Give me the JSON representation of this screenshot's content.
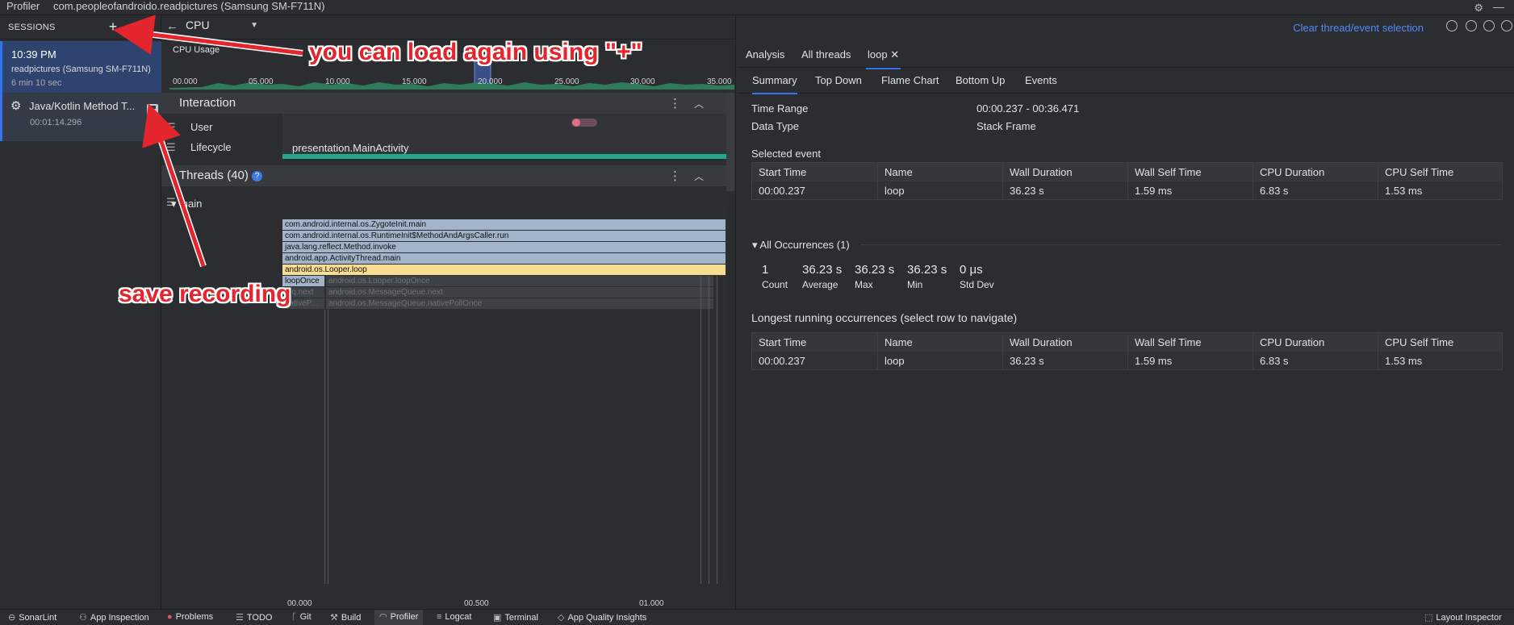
{
  "top": {
    "profiler_tab": "Profiler",
    "session_tab": "com.peopleofandroido.readpictures (Samsung SM-F711N)"
  },
  "sessions": {
    "title": "SESSIONS",
    "add": "+",
    "items": [
      {
        "time": "10:39 PM",
        "device": "readpictures (Samsung SM-F711N)",
        "duration": "6 min 10 sec"
      },
      {
        "name": "Java/Kotlin Method T...",
        "time": "00:01:14.296"
      }
    ]
  },
  "cpu": {
    "selector": "CPU",
    "usage_label": "CPU Usage",
    "ticks": [
      "00.000",
      "05.000",
      "10.000",
      "15.000",
      "20.000",
      "25.000",
      "30.000",
      "35.000"
    ],
    "interaction_title": "Interaction",
    "user_label": "User",
    "lifecycle_label": "Lifecycle",
    "activity": "presentation.MainActivity",
    "threads_title": "Threads (40)",
    "thread_name": "main",
    "frames": [
      {
        "label": "com.android.internal.os.ZygoteInit.main",
        "type": "blue"
      },
      {
        "label": "com.android.internal.os.RuntimeInit$MethodAndArgsCaller.run",
        "type": "blue"
      },
      {
        "label": "java.lang.reflect.Method.invoke",
        "type": "blue"
      },
      {
        "label": "android.app.ActivityThread.main",
        "type": "blue"
      },
      {
        "label": "android.os.Looper.loop",
        "type": "yellow"
      }
    ],
    "loop_once": "loopOnce",
    "dim_frames": [
      "android.os.Looper.loopOnce",
      "android.os.MessageQueue.next",
      "android.os.MessageQueue.nativePollOnce"
    ],
    "dim_small": [
      "a.q.next",
      "nativeP..."
    ],
    "bottom_ticks": [
      "00.000",
      "00.500",
      "01.000"
    ]
  },
  "right": {
    "clear_selection": "Clear thread/event selection",
    "tabs": [
      "Analysis",
      "All threads",
      "loop"
    ],
    "close_glyph": "✕",
    "subtabs": [
      "Summary",
      "Top Down",
      "Flame Chart",
      "Bottom Up",
      "Events"
    ],
    "time_range_label": "Time Range",
    "time_range_value": "00:00.237 - 00:36.471",
    "data_type_label": "Data Type",
    "data_type_value": "Stack Frame",
    "selected_event_title": "Selected event",
    "columns": [
      "Start Time",
      "Name",
      "Wall Duration",
      "Wall Self Time",
      "CPU Duration",
      "CPU Self Time"
    ],
    "selected_row": [
      "00:00.237",
      "loop",
      "36.23 s",
      "1.59 ms",
      "6.83 s",
      "1.53 ms"
    ],
    "occurrences_title": "All Occurrences (1)",
    "stats": [
      {
        "value": "1",
        "label": "Count"
      },
      {
        "value": "36.23 s",
        "label": "Average"
      },
      {
        "value": "36.23 s",
        "label": "Max"
      },
      {
        "value": "36.23 s",
        "label": "Min"
      },
      {
        "value": "0 μs",
        "label": "Std Dev"
      }
    ],
    "longest_title": "Longest running occurrences (select row to navigate)",
    "longest_row": [
      "00:00.237",
      "loop",
      "36.23 s",
      "1.59 ms",
      "6.83 s",
      "1.53 ms"
    ]
  },
  "annotations": {
    "load_again": "you can load again using \"+\"",
    "save_recording": "save recording"
  },
  "bottom": {
    "items": [
      "SonarLint",
      "App Inspection",
      "Problems",
      "TODO",
      "Git",
      "Build",
      "Profiler",
      "Logcat",
      "Terminal",
      "App Quality Insights"
    ],
    "layout_inspector": "Layout Inspector"
  },
  "colors": {
    "accent": "#3574f0",
    "flame_blue": "#a1b4c9",
    "flame_yellow": "#f7dc91",
    "lifecycle_bar": "#25a88f",
    "annotation_red": "#e3262d"
  }
}
